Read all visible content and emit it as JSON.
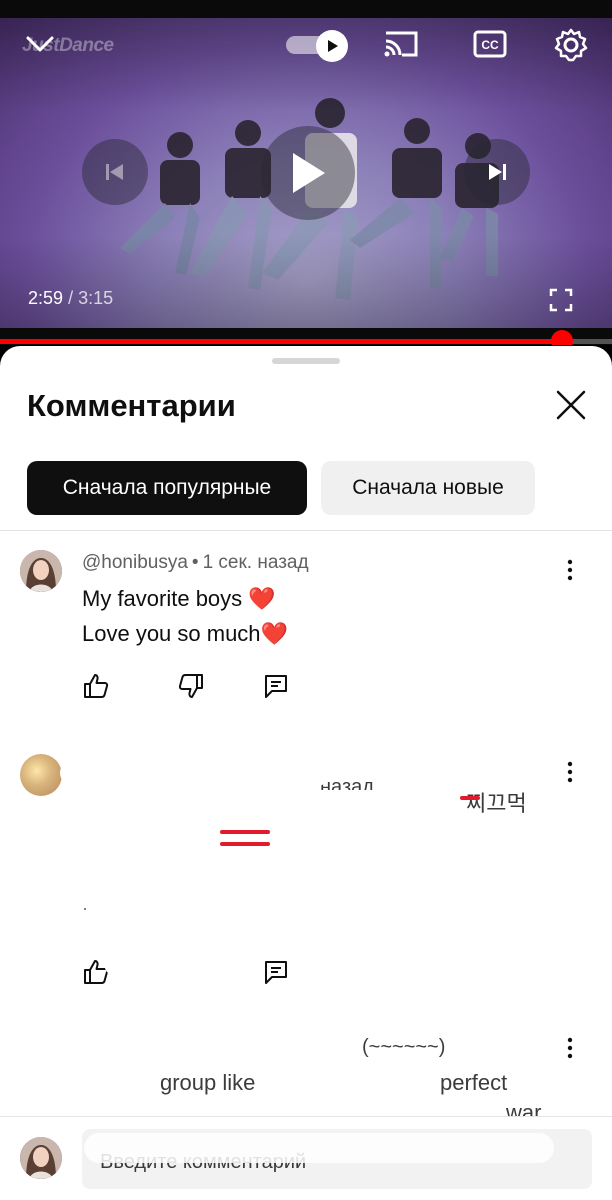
{
  "player": {
    "watermark": "JustDance",
    "current_time": "2:59",
    "time_separator": "/",
    "duration": "3:15",
    "progress": 0.918,
    "autoplay_on": true,
    "icons": [
      "chevron-down-icon",
      "autoplay-toggle",
      "cast-icon",
      "cc-icon",
      "gear-icon",
      "skip-previous-icon",
      "play-icon",
      "skip-next-icon",
      "fullscreen-icon"
    ],
    "colors": {
      "progress": "#ff0000"
    }
  },
  "comments_panel": {
    "title": "Комментарии",
    "sort_chips": [
      {
        "label": "Сначала популярные",
        "selected": true
      },
      {
        "label": "Сначала новые",
        "selected": false
      }
    ],
    "comments": [
      {
        "author": "@honibusya",
        "time": "1 сек. назад",
        "lines": [
          "My favorite boys",
          "Love you so much"
        ],
        "hearts": [
          "❤️",
          "❤️"
        ]
      },
      {
        "author": "",
        "time": "назад",
        "redacted": true,
        "fragments": [
          "찌끄먹"
        ]
      },
      {
        "author": "",
        "redacted": true,
        "fragments": [
          "(~~~~~~)",
          "group like",
          "perfect",
          "war"
        ]
      }
    ],
    "composer": {
      "placeholder": "Введите комментарий"
    }
  }
}
